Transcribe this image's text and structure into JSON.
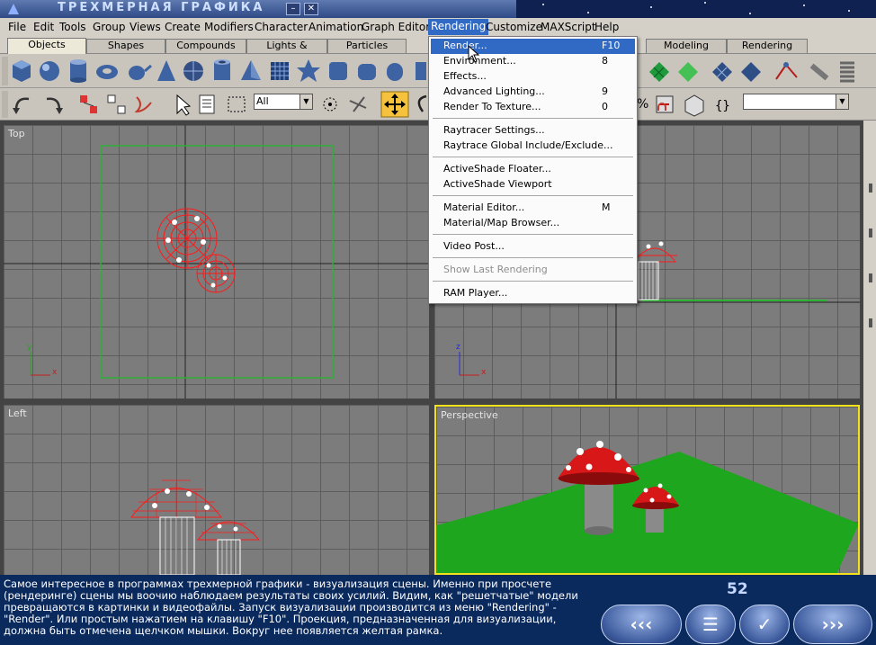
{
  "title": "ТРЕХМЕРНАЯ ГРАФИКА",
  "window_buttons": [
    "–",
    "✕"
  ],
  "menu": [
    "File",
    "Edit",
    "Tools",
    "Group",
    "Views",
    "Create",
    "Modifiers",
    "Character",
    "Animation",
    "Graph Editors",
    "Rendering",
    "Customize",
    "MAXScript",
    "Help"
  ],
  "tabs": [
    "Objects",
    "Shapes",
    "Compounds",
    "Lights & Cameras",
    "Particles",
    "Modeling",
    "Rendering"
  ],
  "selection_filter": "All",
  "rendering_menu": [
    {
      "label": "Render...",
      "shortcut": "F10",
      "state": "highlighted"
    },
    {
      "label": "Environment...",
      "shortcut": "8"
    },
    {
      "label": "Effects...",
      "shortcut": ""
    },
    {
      "label": "Advanced Lighting...",
      "shortcut": "9"
    },
    {
      "label": "Render To Texture...",
      "shortcut": "0"
    },
    {
      "label": "Raytracer Settings...",
      "shortcut": ""
    },
    {
      "label": "Raytrace Global Include/Exclude...",
      "shortcut": ""
    },
    {
      "label": "ActiveShade Floater...",
      "shortcut": ""
    },
    {
      "label": "ActiveShade Viewport",
      "shortcut": ""
    },
    {
      "label": "Material Editor...",
      "shortcut": "M"
    },
    {
      "label": "Material/Map Browser...",
      "shortcut": ""
    },
    {
      "label": "Video Post...",
      "shortcut": ""
    },
    {
      "label": "Show Last Rendering",
      "shortcut": "",
      "state": "disabled"
    },
    {
      "label": "RAM Player...",
      "shortcut": ""
    }
  ],
  "viewports": {
    "top": "Top",
    "front": "",
    "left": "Left",
    "perspective": "Perspective"
  },
  "axis": {
    "x": "x",
    "y": "y",
    "z": "z"
  },
  "description": "Самое интересное в программах трехмерной графики - визуализация сцены. Именно при просчете (рендеринге) сцены мы воочию наблюдаем результаты своих усилий. Видим, как \"решетчатые\" модели превращаются в картинки и видеофайлы. Запуск визуализации производится из меню \"Rendering\" - \"Render\". Или простым нажатием на клавишу \"F10\". Проекция, предназначенная для визуализации, должна быть отмечена щелчком мышки. Вокруг нее появляется желтая рамка.",
  "page_number": "52",
  "nav_buttons": {
    "prev": "‹‹‹",
    "contents": "☰",
    "check": "✓",
    "next": "›››"
  },
  "colors": {
    "selected_viewport": "#f2e21c",
    "wireframe": "#ff1a1a",
    "ground": "#1fa61f",
    "menu_highlight": "#316ac5",
    "panel": "#0a2a5e"
  }
}
